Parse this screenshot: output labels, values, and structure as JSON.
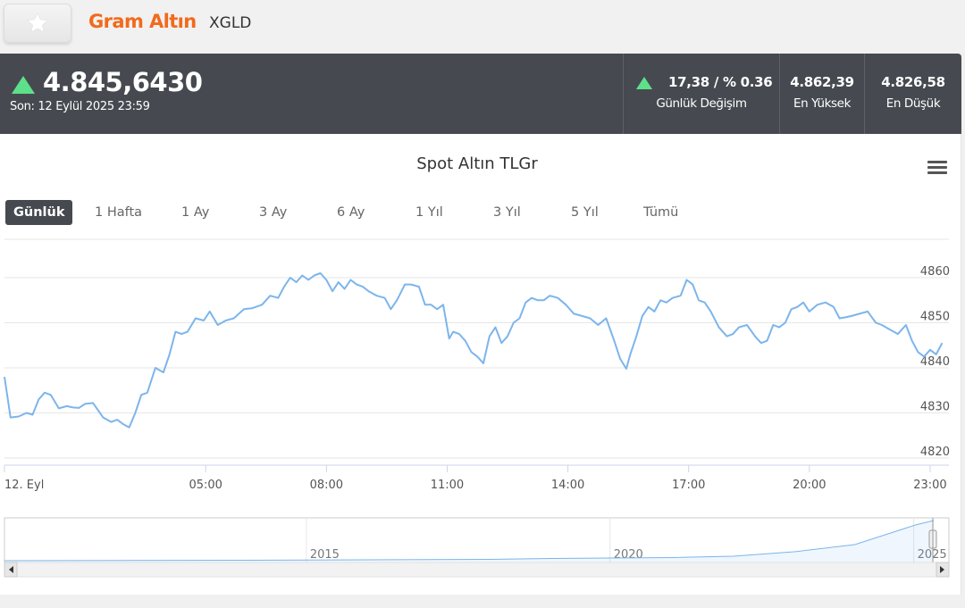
{
  "header": {
    "favorite_icon": "star-icon",
    "asset_name": "Gram Altın",
    "asset_code": "XGLD"
  },
  "quote": {
    "direction": "up",
    "price": "4.845,6430",
    "last_update": "Son: 12 Eylül 2025 23:59",
    "daily_change_value": "17,38 / % 0.36",
    "daily_change_label": "Günlük Değişim",
    "high_value": "4.862,39",
    "high_label": "En Yüksek",
    "low_value": "4.826,58",
    "low_label": "En Düşük",
    "up_color": "#5ee08a"
  },
  "chart": {
    "title": "Spot Altın TLGr",
    "menu_icon": "hamburger-menu-icon",
    "ranges": [
      "Günlük",
      "1 Hafta",
      "1 Ay",
      "3 Ay",
      "6 Ay",
      "1 Yıl",
      "3 Yıl",
      "5 Yıl",
      "Tümü"
    ],
    "active_range": "Günlük",
    "line_color": "#7cb5ec"
  },
  "chart_data": {
    "type": "line",
    "title": "Spot Altın TLGr",
    "x_tick_labels": [
      "12. Eyl",
      "05:00",
      "08:00",
      "11:00",
      "14:00",
      "17:00",
      "20:00",
      "23:00"
    ],
    "x_tick_hours": [
      0,
      5,
      8,
      11,
      14,
      17,
      20,
      23
    ],
    "x_range_hours": [
      0,
      24
    ],
    "y_ticks": [
      4820,
      4830,
      4840,
      4850,
      4860
    ],
    "ylim": [
      4820,
      4862
    ],
    "grid": true,
    "series": [
      {
        "values_hours": [
          0,
          0.15,
          0.35,
          0.55,
          0.7,
          0.85,
          1.0,
          1.15,
          1.35,
          1.55,
          1.7,
          1.85,
          2.0,
          2.2,
          2.45,
          2.65,
          2.8,
          2.95,
          3.1,
          3.25,
          3.4,
          3.55,
          3.75,
          3.95,
          4.1,
          4.25,
          4.4,
          4.55,
          4.75,
          4.95,
          5.1,
          5.3,
          5.5,
          5.7,
          5.95,
          6.15,
          6.4,
          6.6,
          6.8,
          6.95,
          7.1,
          7.25,
          7.4,
          7.55,
          7.7,
          7.85,
          8.0,
          8.15,
          8.3,
          8.45,
          8.6,
          8.75,
          8.9,
          9.05,
          9.25,
          9.45,
          9.6,
          9.75,
          9.95,
          10.1,
          10.3,
          10.45,
          10.6,
          10.75,
          10.9,
          11.05,
          11.15,
          11.3,
          11.45,
          11.6,
          11.75,
          11.9,
          12.05,
          12.2,
          12.35,
          12.5,
          12.65,
          12.8,
          12.95,
          13.1,
          13.25,
          13.4,
          13.55,
          13.75,
          13.95,
          14.15,
          14.35,
          14.55,
          14.75,
          14.95,
          15.15,
          15.3,
          15.45,
          15.55,
          15.7,
          15.85,
          16.0,
          16.15,
          16.3,
          16.45,
          16.6,
          16.8,
          16.95,
          17.1,
          17.25,
          17.4,
          17.55,
          17.75,
          17.95,
          18.1,
          18.25,
          18.45,
          18.65,
          18.8,
          18.95,
          19.1,
          19.25,
          19.4,
          19.55,
          19.7,
          19.85,
          20.0,
          20.2,
          20.4,
          20.6,
          20.75,
          20.9,
          21.05,
          21.25,
          21.45,
          21.65,
          21.8,
          22.0,
          22.2,
          22.4,
          22.55,
          22.7,
          22.85,
          23.0,
          23.15,
          23.3,
          23.45,
          23.6,
          23.75,
          23.9
        ],
        "values": [
          4838,
          4829,
          4829.2,
          4830,
          4829.6,
          4833,
          4834.5,
          4834,
          4831,
          4831.5,
          4831.2,
          4831.1,
          4832,
          4832.2,
          4829,
          4828,
          4828.5,
          4827.5,
          4826.8,
          4830,
          4834,
          4834.5,
          4840,
          4839,
          4843,
          4848,
          4847.5,
          4848,
          4851,
          4850.5,
          4852.5,
          4849.5,
          4850.5,
          4851,
          4853,
          4853.2,
          4854,
          4856,
          4855.5,
          4858,
          4860,
          4859,
          4860.5,
          4859.5,
          4860.5,
          4861,
          4859.5,
          4857,
          4859,
          4857.5,
          4859.5,
          4858.5,
          4858,
          4857,
          4856,
          4855.5,
          4853,
          4855,
          4858.5,
          4858.5,
          4858,
          4854,
          4854,
          4853,
          4854,
          4846.5,
          4848,
          4847.5,
          4846,
          4843.5,
          4842.5,
          4841,
          4847,
          4849,
          4845.5,
          4847,
          4850,
          4851,
          4854.5,
          4855.5,
          4855,
          4855,
          4856,
          4855.5,
          4854,
          4852,
          4851.5,
          4851,
          4849.5,
          4851,
          4846,
          4842,
          4839.8,
          4843,
          4847,
          4851.5,
          4853.5,
          4852.5,
          4855,
          4854.5,
          4855.5,
          4856,
          4859.5,
          4858.5,
          4855,
          4854.5,
          4852.5,
          4849,
          4847,
          4847.5,
          4849,
          4849.5,
          4847,
          4845.5,
          4846,
          4849.5,
          4849,
          4850,
          4853,
          4853.5,
          4854.5,
          4852.5,
          4854,
          4854.5,
          4853.5,
          4851,
          4851.2,
          4851.5,
          4852,
          4852.5,
          4850,
          4849.5,
          4848.5,
          4847.5,
          4849.5,
          4846,
          4843.5,
          4842.5,
          4844,
          4843,
          4845.5
        ]
      }
    ],
    "navigator": {
      "x_tick_labels": [
        "2015",
        "2020",
        "2025"
      ],
      "x_tick_years": [
        2015,
        2020,
        2025
      ],
      "x_range_years": [
        2010,
        2025.3
      ]
    }
  }
}
